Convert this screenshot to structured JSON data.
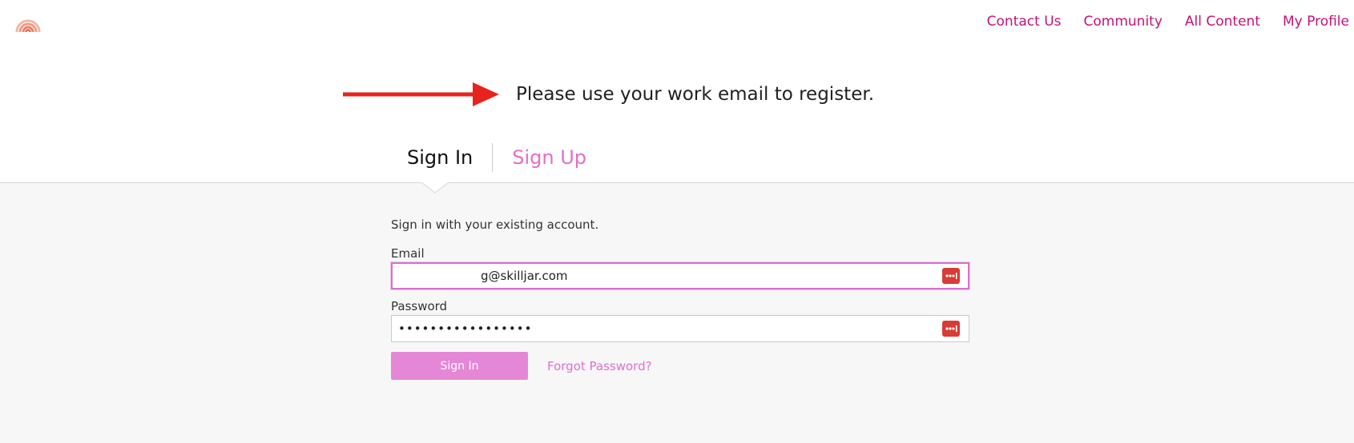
{
  "nav": {
    "logo": "rainbow-logo",
    "links": [
      "Contact Us",
      "Community",
      "All Content",
      "My Profile"
    ]
  },
  "notice": {
    "text": "Please use your work email to register."
  },
  "tabs": {
    "signin": "Sign In",
    "signup": "Sign Up"
  },
  "form": {
    "intro": "Sign in with your existing account.",
    "email_label": "Email",
    "email_value": "g@skilljar.com",
    "password_label": "Password",
    "password_value": "•••••••••••••••••",
    "signin_button": "Sign In",
    "forgot_link": "Forgot Password?"
  },
  "colors": {
    "accent": "#c4117a",
    "tab_inactive": "#e06fce",
    "button": "#e587d7",
    "arrow": "#e8231e",
    "password_manager": "#d93b36"
  },
  "icons": [
    "rainbow-logo",
    "arrow-right-icon",
    "password-manager-icon"
  ]
}
